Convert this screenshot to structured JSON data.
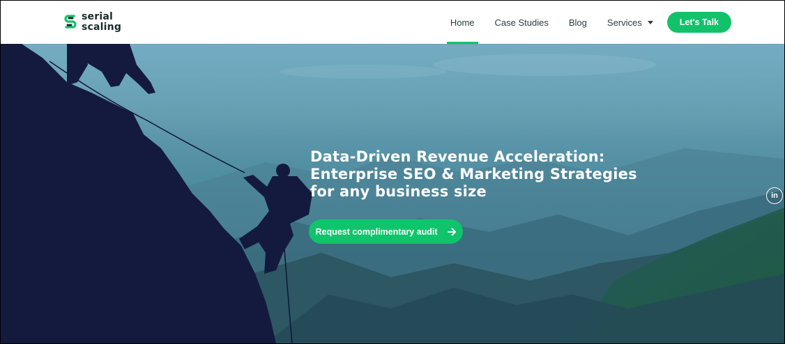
{
  "brand": {
    "name_line1": "serial",
    "name_line2": "scaling",
    "accent": "#11c26b",
    "icon": "serial-scaling-logo-icon"
  },
  "nav": {
    "items": [
      {
        "label": "Home",
        "active": true
      },
      {
        "label": "Case Studies",
        "active": false
      },
      {
        "label": "Blog",
        "active": false
      },
      {
        "label": "Services",
        "active": false,
        "has_dropdown": true
      }
    ],
    "cta_label": "Let's Talk"
  },
  "hero": {
    "title_lines": [
      "Data-Driven Revenue Acceleration:",
      "Enterprise SEO & Marketing Strategies",
      "for any business size"
    ],
    "button_label": "Request complimentary audit",
    "button_icon": "arrow-right-icon",
    "background_image": "climbers-silhouette-mountain-valley"
  },
  "social": {
    "linkedin_label": "in"
  }
}
